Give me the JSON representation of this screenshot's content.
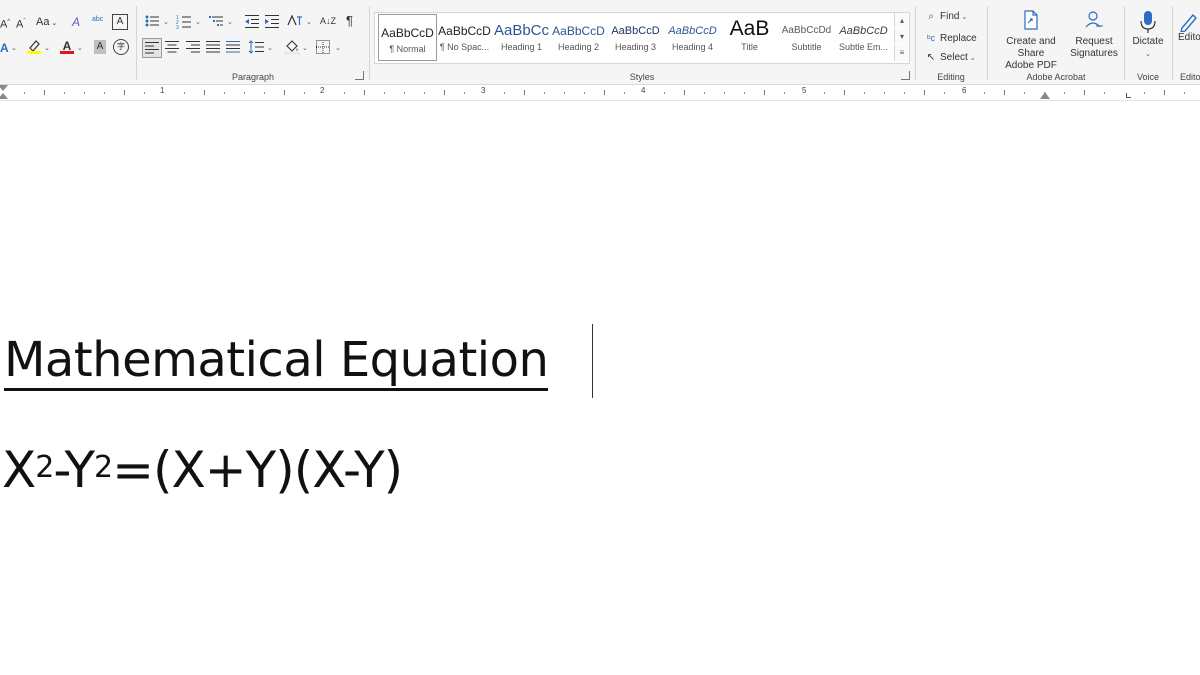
{
  "ribbon": {
    "font": {
      "grow_shrink": "A",
      "change_case": "Aa",
      "clear_formatting": "A",
      "phonetic": "abc",
      "char_border": "A",
      "text_effects": "A",
      "highlight": "ab",
      "font_color": "A",
      "char_shading": "A",
      "enclose": "字"
    },
    "paragraph": {
      "label": "Paragraph",
      "sort": "A↓Z",
      "show_marks": "¶"
    },
    "styles": {
      "label": "Styles",
      "items": [
        {
          "preview": "AaBbCcD",
          "name": "¶ Normal",
          "color": "#222222"
        },
        {
          "preview": "AaBbCcD",
          "name": "¶ No Spac...",
          "color": "#222222"
        },
        {
          "preview": "AaBbCc",
          "name": "Heading 1",
          "color": "#2f5597"
        },
        {
          "preview": "AaBbCcD",
          "name": "Heading 2",
          "color": "#2f5597"
        },
        {
          "preview": "AaBbCcD",
          "name": "Heading 3",
          "color": "#1f3864"
        },
        {
          "preview": "AaBbCcD",
          "name": "Heading 4",
          "color": "#2f5597"
        },
        {
          "preview": "AaB",
          "name": "Title",
          "color": "#111111"
        },
        {
          "preview": "AaBbCcDd",
          "name": "Subtitle",
          "color": "#5a5a5a"
        },
        {
          "preview": "AaBbCcD",
          "name": "Subtle Em...",
          "color": "#404040"
        }
      ]
    },
    "editing": {
      "label": "Editing",
      "find": "Find",
      "replace": "Replace",
      "select": "Select"
    },
    "acrobat": {
      "label": "Adobe Acrobat",
      "create_share_line1": "Create and Share",
      "create_share_line2": "Adobe PDF",
      "request_line1": "Request",
      "request_line2": "Signatures"
    },
    "voice": {
      "label": "Voice",
      "dictate": "Dictate"
    },
    "editor": {
      "label": "Edito",
      "button": "Edito"
    }
  },
  "ruler": {
    "numbers": [
      "1",
      "2",
      "3",
      "4",
      "5",
      "6"
    ]
  },
  "document": {
    "title": "Mathematical Equation",
    "equation": {
      "x": "X",
      "exp1": "2",
      "minus_y": "-Y",
      "exp2": "2",
      "rest": "=(X+Y)(X-Y)"
    }
  },
  "colors": {
    "accent": "#2b6cc4",
    "highlight_yellow": "#ffff00",
    "font_red": "#e81123"
  }
}
